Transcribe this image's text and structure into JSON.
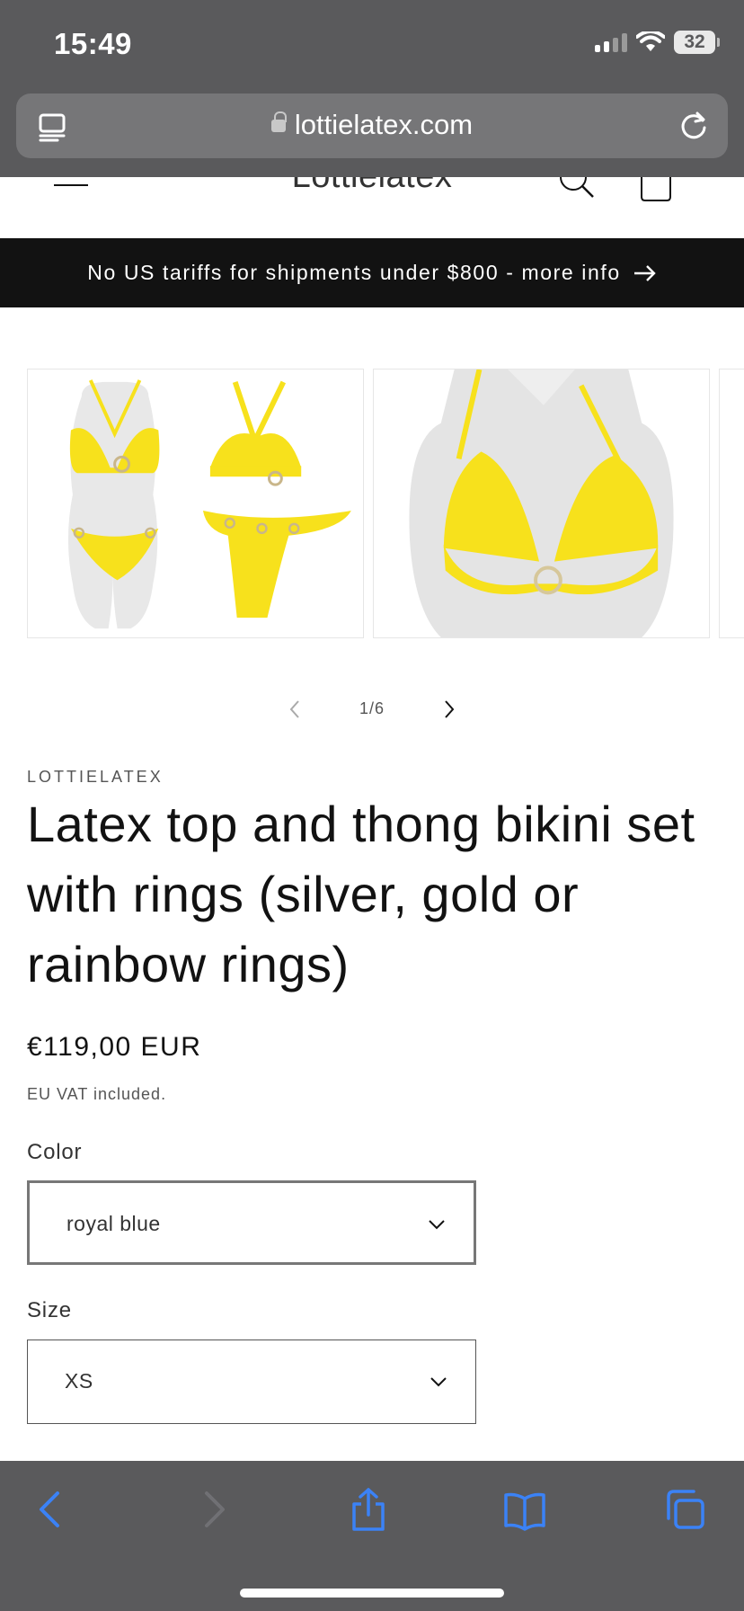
{
  "status_bar": {
    "time": "15:49",
    "battery": "32"
  },
  "browser": {
    "url": "lottielatex.com"
  },
  "header": {
    "logo": "Lottielatex"
  },
  "announcement": {
    "text": "No US tariffs for shipments under $800 - more info"
  },
  "gallery": {
    "counter": "1/6",
    "image_color": "#f7e11c"
  },
  "product": {
    "vendor": "LOTTIELATEX",
    "title": "Latex top and thong bikini set with rings (silver, gold or rainbow rings)",
    "price": "€119,00 EUR",
    "tax_note": "EU VAT included.",
    "options": [
      {
        "label": "Color",
        "value": "royal blue"
      },
      {
        "label": "Size",
        "value": "XS"
      }
    ]
  },
  "toolbar": {
    "icons": [
      "back-icon",
      "forward-icon",
      "share-icon",
      "bookmarks-icon",
      "tabs-icon"
    ],
    "accent": "#3b82f6"
  }
}
